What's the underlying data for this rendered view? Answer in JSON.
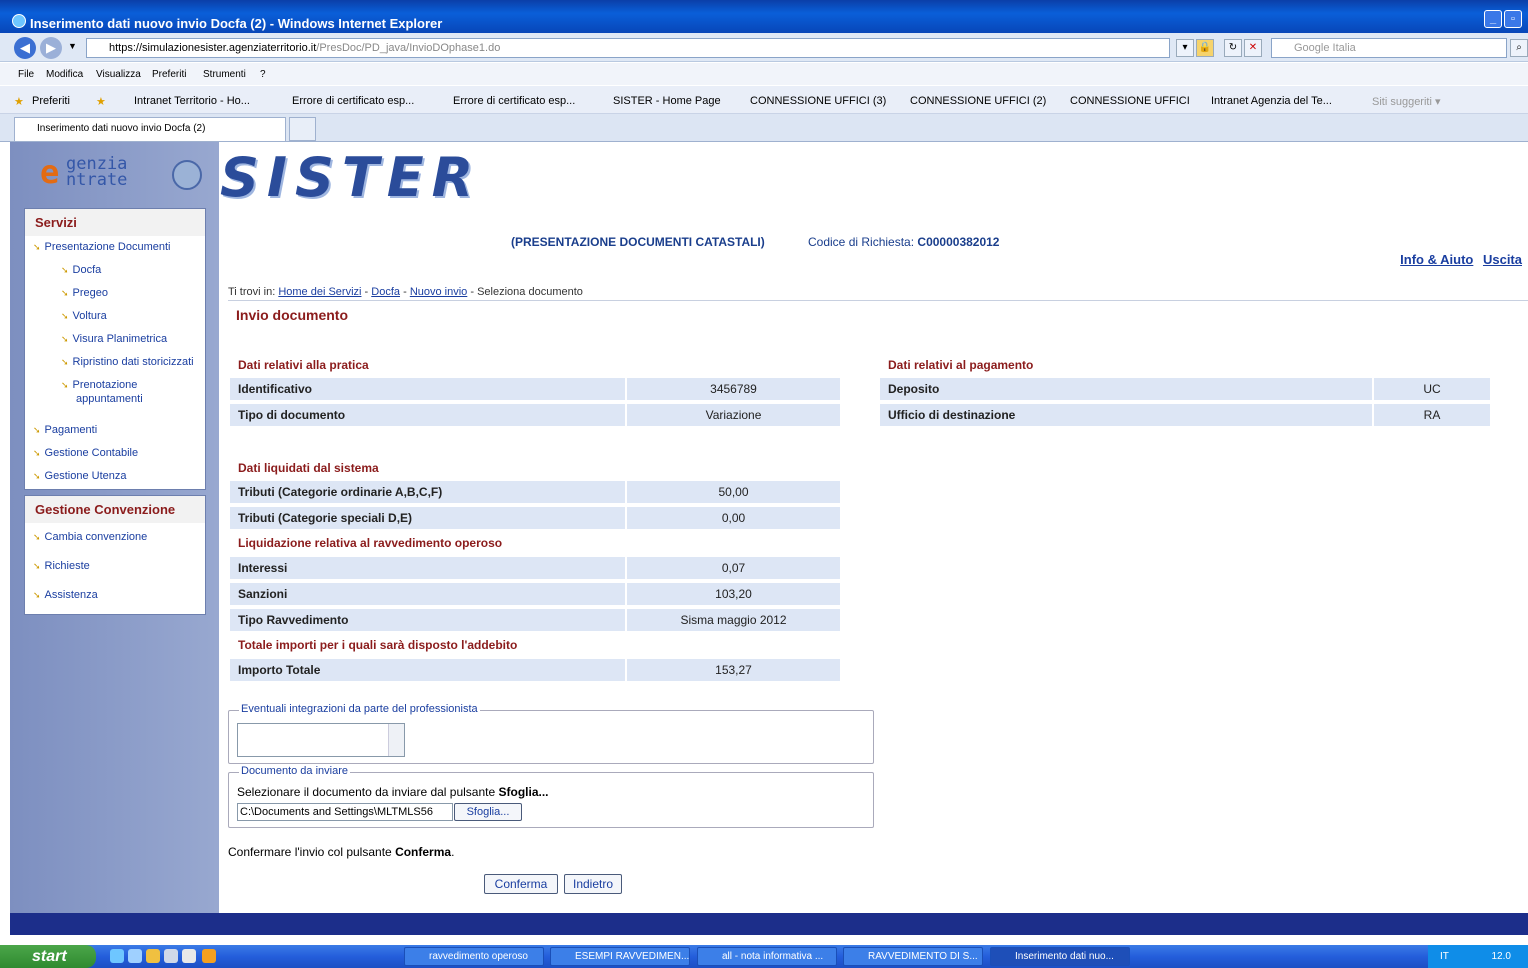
{
  "window": {
    "title": "Inserimento dati nuovo invio Docfa (2) - Windows Internet Explorer"
  },
  "address": {
    "url_main": "https://simulazionesister.agenziaterritorio.it",
    "url_path": "/PresDoc/PD_java/InvioDOphase1.do",
    "search_placeholder": "Google Italia"
  },
  "menu": [
    "File",
    "Modifica",
    "Visualizza",
    "Preferiti",
    "Strumenti",
    "?"
  ],
  "favorites": {
    "label": "Preferiti",
    "items": [
      "Intranet Territorio - Ho...",
      "Errore di certificato esp...",
      "Errore di certificato esp...",
      "SISTER - Home Page",
      "CONNESSIONE UFFICI (3)",
      "CONNESSIONE UFFICI (2)",
      "CONNESSIONE UFFICI",
      "Intranet Agenzia del Te...",
      "Siti suggeriti ▾"
    ]
  },
  "tab": {
    "label": "Inserimento dati nuovo invio Docfa (2)"
  },
  "logo": {
    "agenzia_line1": "genzia",
    "agenzia_line2": "ntrate",
    "sister": "SISTER"
  },
  "sidebar": {
    "servizi_title": "Servizi",
    "presentazione": "Presentazione Documenti",
    "sub": [
      "Docfa",
      "Pregeo",
      "Voltura",
      "Visura Planimetrica",
      "Ripristino dati storicizzati",
      "Prenotazione",
      "appuntamenti"
    ],
    "pagamenti": "Pagamenti",
    "gestione_contabile": "Gestione Contabile",
    "gestione_utenza": "Gestione Utenza",
    "conv_title": "Gestione Convenzione",
    "conv_items": [
      "Cambia convenzione",
      "Richieste",
      "Assistenza"
    ]
  },
  "header": {
    "service": "(PRESENTAZIONE DOCUMENTI CATASTALI)",
    "code_label": "Codice di Richiesta:",
    "code_value": "C00000382012",
    "info": "Info & Aiuto",
    "exit": "Uscita"
  },
  "breadcrumb": {
    "prefix": "Ti trovi in:",
    "home": "Home dei Servizi",
    "docfa": "Docfa",
    "nuovo": "Nuovo invio",
    "current": "Seleziona documento",
    "sep": "-"
  },
  "main": {
    "title": "Invio documento",
    "pratica_title": "Dati relativi alla pratica",
    "pratica": [
      {
        "k": "Identificativo",
        "v": "3456789"
      },
      {
        "k": "Tipo di documento",
        "v": "Variazione"
      }
    ],
    "pagamento_title": "Dati relativi al pagamento",
    "pagamento": [
      {
        "k": "Deposito",
        "v": "UC"
      },
      {
        "k": "Ufficio di destinazione",
        "v": "RA"
      }
    ],
    "liquidati_title": "Dati liquidati dal sistema",
    "liquidati": [
      {
        "k": "Tributi (Categorie ordinarie A,B,C,F)",
        "v": "50,00"
      },
      {
        "k": "Tributi (Categorie speciali D,E)",
        "v": "0,00"
      }
    ],
    "ravv_title": "Liquidazione relativa al ravvedimento operoso",
    "ravv": [
      {
        "k": "Interessi",
        "v": "0,07"
      },
      {
        "k": "Sanzioni",
        "v": "103,20"
      },
      {
        "k": "Tipo Ravvedimento",
        "v": "Sisma maggio 2012"
      }
    ],
    "totale_title": "Totale importi per i quali sarà disposto l'addebito",
    "totale": [
      {
        "k": "Importo Totale",
        "v": "153,27"
      }
    ],
    "integrazioni_legend": "Eventuali integrazioni da parte del professionista",
    "documento_legend": "Documento da inviare",
    "doc_instr_pre": "Selezionare il documento da inviare dal pulsante",
    "doc_instr_bold": "Sfoglia...",
    "file_value": "C:\\Documents and Settings\\MLTMLS56",
    "browse": "Sfoglia...",
    "confirm_pre": "Confermare l'invio col pulsante",
    "confirm_bold": "Conferma",
    "confirm_dot": ".",
    "btn_conferma": "Conferma",
    "btn_indietro": "Indietro"
  },
  "taskbar": {
    "start": "start",
    "tasks": [
      "ravvedimento operoso",
      "ESEMPI RAVVEDIMEN...",
      "all - nota informativa ...",
      "RAVVEDIMENTO DI S...",
      "Inserimento dati nuo..."
    ],
    "lang": "IT",
    "clock": "12.0"
  },
  "colors": {
    "accent": "#1a3ea0",
    "title_red": "#8b1c1c",
    "row_bg": "#dde6f5"
  }
}
